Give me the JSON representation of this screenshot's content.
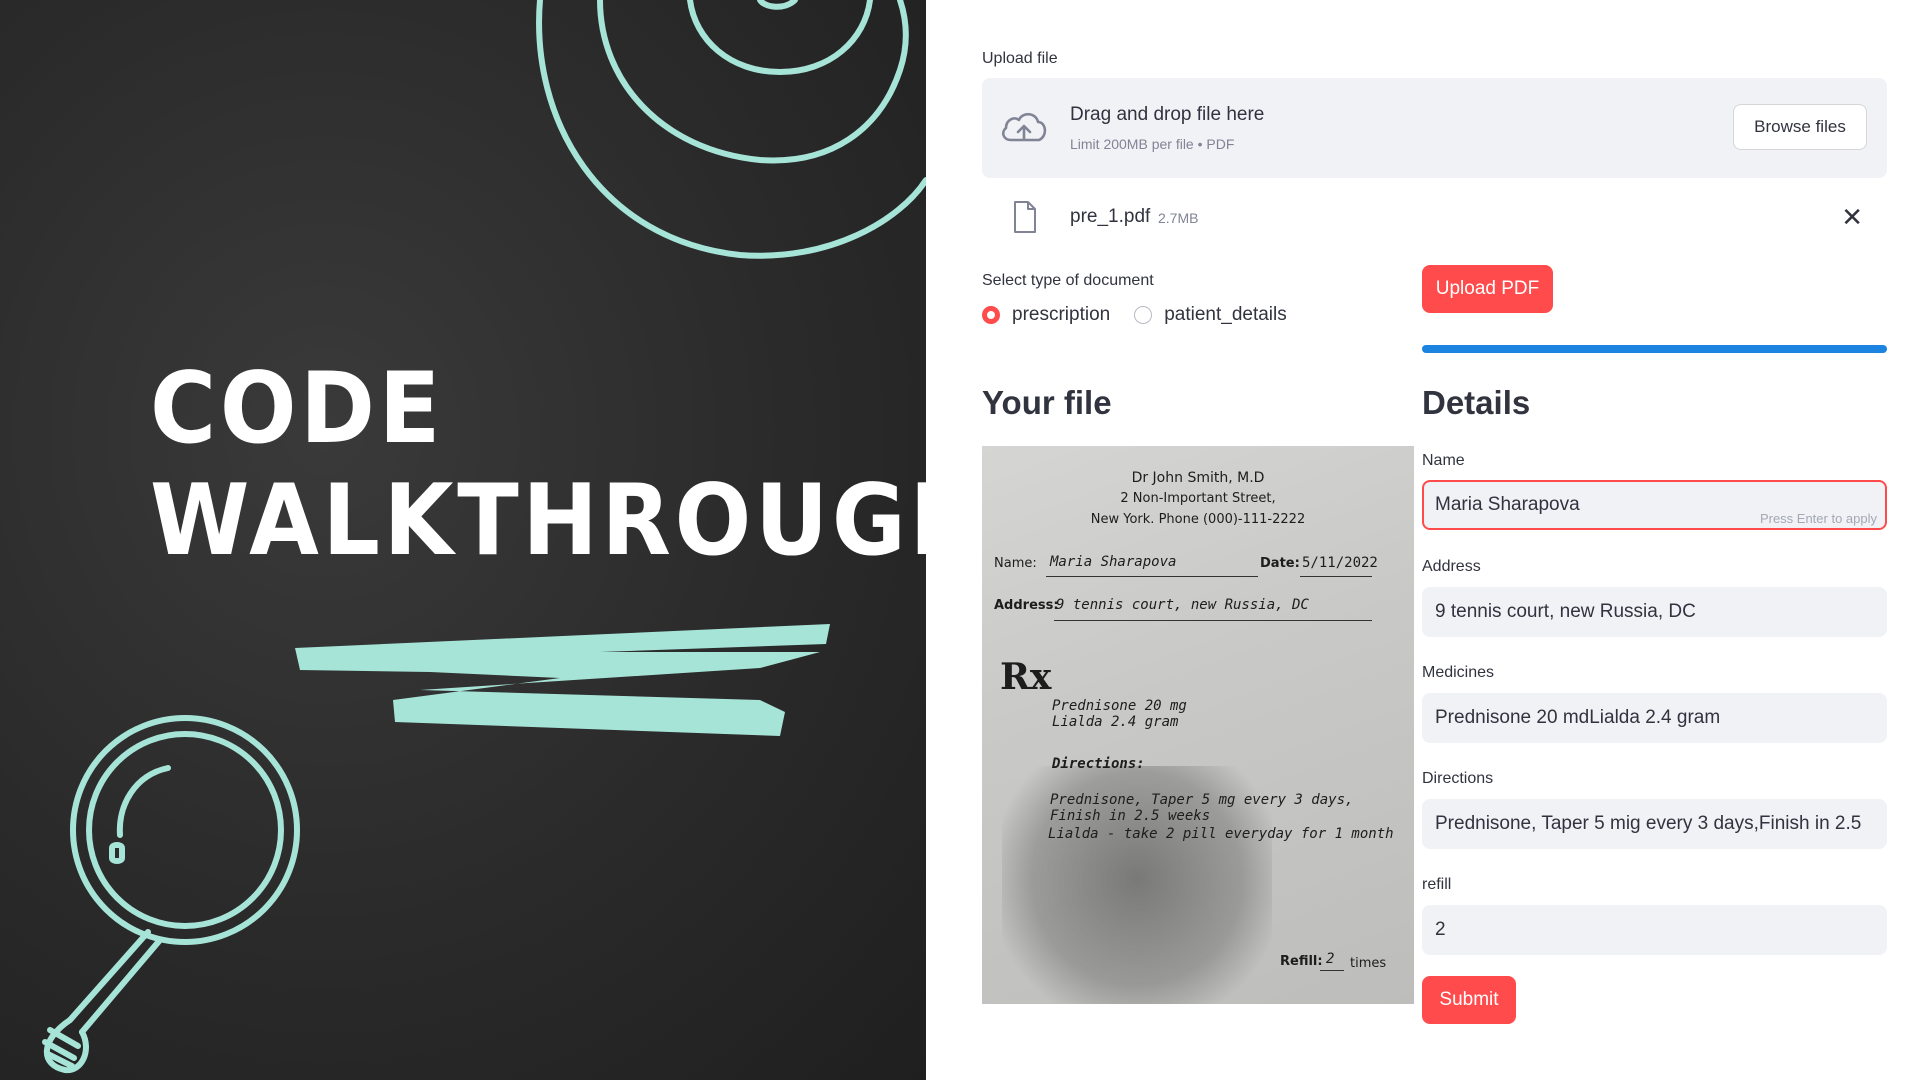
{
  "title": {
    "line1": "CODE",
    "line2": "WALKTHROUGH"
  },
  "colors": {
    "accent": "#ff4b4b",
    "chalk": "#a7e4d8",
    "progress": "#1c83e1",
    "board": "#2b2b2b"
  },
  "upload": {
    "label": "Upload file",
    "drop_text": "Drag and drop file here",
    "limit_text": "Limit 200MB per file • PDF",
    "browse_label": "Browse files",
    "icon": "cloud-upload-icon"
  },
  "file": {
    "name": "pre_1.pdf",
    "size": "2.7MB",
    "icon": "document-icon",
    "remove_icon": "close-icon",
    "remove_glyph": "✕"
  },
  "doc_type": {
    "label": "Select type of document",
    "options": [
      "prescription",
      "patient_details"
    ],
    "selected": "prescription"
  },
  "upload_pdf_label": "Upload PDF",
  "progress": 1.0,
  "your_file": {
    "heading": "Your file",
    "doc": {
      "doctor": "Dr John Smith, M.D",
      "street": "2 Non-Important Street,",
      "city": "New York. Phone (000)-111-2222",
      "name_label": "Name:",
      "name_value": "Maria Sharapova",
      "date_label": "Date:",
      "date_value": "5/11/2022",
      "address_label": "Address:",
      "address_value": "9 tennis court, new Russia, DC",
      "rx": "Rx",
      "med1": "Prednisone 20 mg",
      "med2": "Lialda 2.4 gram",
      "directions_label": "Directions:",
      "dir1": "Prednisone, Taper 5 mg every 3 days,",
      "dir2": "Finish in 2.5 weeks",
      "dir3": "Lialda - take 2 pill everyday for 1 month",
      "refill_label": "Refill:",
      "refill_value": "2",
      "refill_suffix": "times"
    }
  },
  "details": {
    "heading": "Details",
    "name": {
      "label": "Name",
      "value": "Maria Sharapova",
      "hint": "Press Enter to apply"
    },
    "address": {
      "label": "Address",
      "value": "9 tennis court, new Russia, DC"
    },
    "medicines": {
      "label": "Medicines",
      "value": "Prednisone 20 mdLialda 2.4 gram"
    },
    "directions": {
      "label": "Directions",
      "value": "Prednisone, Taper 5 mig every 3 days,Finish in 2.5"
    },
    "refill": {
      "label": "refill",
      "value": "2"
    },
    "submit_label": "Submit"
  }
}
